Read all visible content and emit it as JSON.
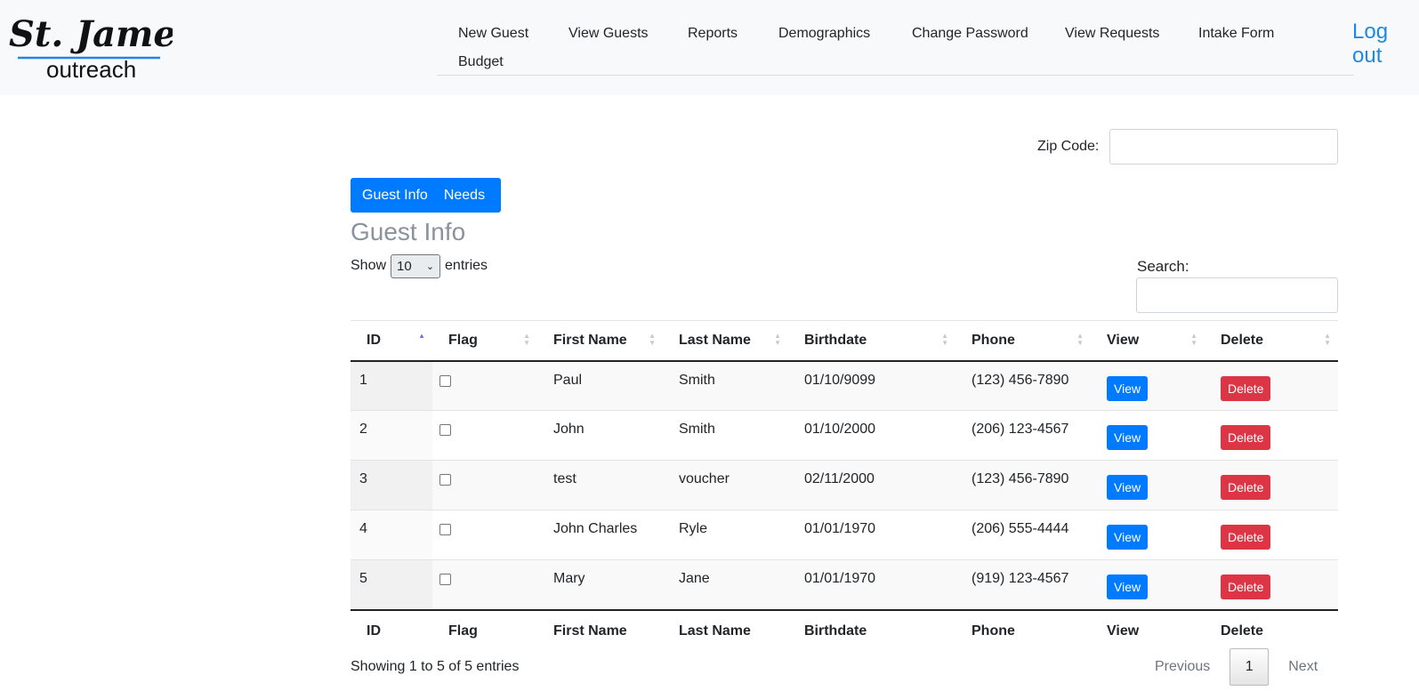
{
  "logo": {
    "line1": "St. James",
    "line2": "outreach"
  },
  "nav": {
    "links": [
      "New Guest",
      "View Guests",
      "Reports",
      "Demographics",
      "Change Password",
      "View Requests",
      "Intake Form",
      "Budget"
    ],
    "logout": "Log out"
  },
  "zip": {
    "label": "Zip Code:",
    "value": ""
  },
  "tabs": [
    "Guest Info",
    "Needs"
  ],
  "section_title": "Guest Info",
  "show": {
    "prefix": "Show",
    "selected": "10",
    "suffix": "entries"
  },
  "search": {
    "label": "Search:",
    "value": ""
  },
  "table": {
    "columns": [
      "ID",
      "Flag",
      "First Name",
      "Last Name",
      "Birthdate",
      "Phone",
      "View",
      "Delete"
    ],
    "rows": [
      {
        "id": "1",
        "first": "Paul",
        "last": "Smith",
        "birth": "01/10/9099",
        "phone": "(123) 456-7890"
      },
      {
        "id": "2",
        "first": "John",
        "last": "Smith",
        "birth": "01/10/2000",
        "phone": "(206) 123-4567"
      },
      {
        "id": "3",
        "first": "test",
        "last": "voucher",
        "birth": "02/11/2000",
        "phone": "(123) 456-7890"
      },
      {
        "id": "4",
        "first": "John Charles",
        "last": "Ryle",
        "birth": "01/01/1970",
        "phone": "(206) 555-4444"
      },
      {
        "id": "5",
        "first": "Mary",
        "last": "Jane",
        "birth": "01/01/1970",
        "phone": "(919) 123-4567"
      }
    ],
    "view_label": "View",
    "delete_label": "Delete"
  },
  "footer": {
    "info": "Showing 1 to 5 of 5 entries",
    "prev": "Previous",
    "page": "1",
    "next": "Next"
  },
  "colors": {
    "primary": "#007bff",
    "danger": "#dc3545",
    "logout": "#1e88e5"
  }
}
